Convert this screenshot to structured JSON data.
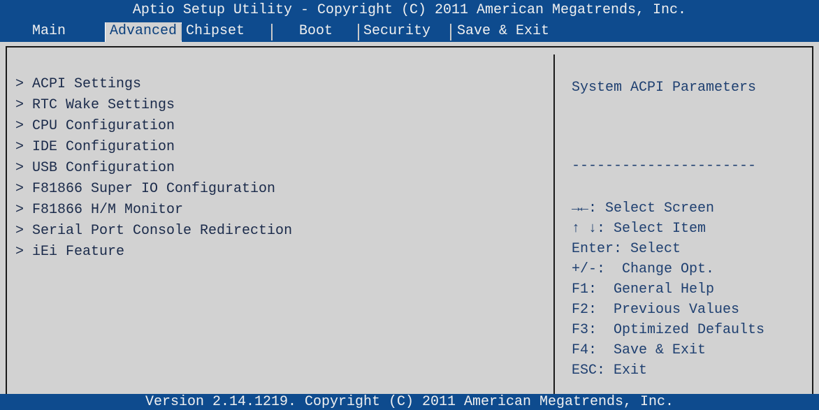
{
  "header": {
    "title": "Aptio Setup Utility - Copyright (C) 2011 American Megatrends, Inc."
  },
  "tabs": [
    {
      "label": "Main"
    },
    {
      "label": "Advanced",
      "active": true
    },
    {
      "label": "Chipset"
    },
    {
      "label": "Boot"
    },
    {
      "label": "Security"
    },
    {
      "label": "Save & Exit"
    }
  ],
  "menu": {
    "items": [
      "> ACPI Settings",
      "> RTC Wake Settings",
      "> CPU Configuration",
      "> IDE Configuration",
      "> USB Configuration",
      "> F81866 Super IO Configuration",
      "> F81866 H/M Monitor",
      "> Serial Port Console Redirection",
      "> iEi Feature"
    ]
  },
  "help": {
    "description": "System ACPI Parameters",
    "separator": "----------------------",
    "keys": [
      "→←: Select Screen",
      "↑ ↓: Select Item",
      "Enter: Select",
      "+/-:  Change Opt.",
      "F1:  General Help",
      "F2:  Previous Values",
      "F3:  Optimized Defaults",
      "F4:  Save & Exit",
      "ESC: Exit"
    ]
  },
  "footer": {
    "version": "Version 2.14.1219. Copyright (C) 2011 American Megatrends, Inc."
  },
  "colors": {
    "bar_blue": "#0e4b8e",
    "panel_gray": "#d2d2d2",
    "text_blue": "#1e3f70"
  }
}
